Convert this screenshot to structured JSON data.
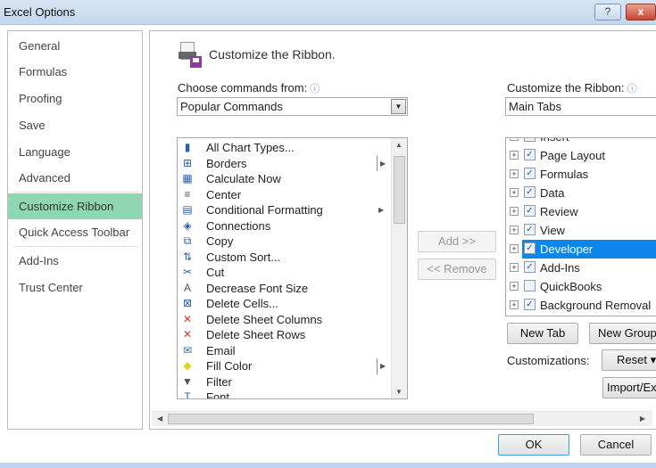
{
  "window": {
    "title": "Excel Options",
    "help": "?",
    "close": "x"
  },
  "nav": {
    "items": [
      {
        "label": "General"
      },
      {
        "label": "Formulas"
      },
      {
        "label": "Proofing"
      },
      {
        "label": "Save"
      },
      {
        "label": "Language"
      },
      {
        "label": "Advanced"
      },
      {
        "label": "Customize Ribbon",
        "selected": true
      },
      {
        "label": "Quick Access Toolbar"
      },
      {
        "label": "Add-Ins"
      },
      {
        "label": "Trust Center"
      }
    ]
  },
  "header": {
    "title": "Customize the Ribbon."
  },
  "left": {
    "label": "Choose commands from:",
    "value": "Popular Commands",
    "commands": [
      {
        "label": "All Chart Types...",
        "icon": "chart-icon"
      },
      {
        "label": "Borders",
        "icon": "borders-icon",
        "submenu": "split"
      },
      {
        "label": "Calculate Now",
        "icon": "calculator-icon"
      },
      {
        "label": "Center",
        "icon": "align-center-icon"
      },
      {
        "label": "Conditional Formatting",
        "icon": "conditional-formatting-icon",
        "submenu": "arrow"
      },
      {
        "label": "Connections",
        "icon": "connections-icon"
      },
      {
        "label": "Copy",
        "icon": "copy-icon"
      },
      {
        "label": "Custom Sort...",
        "icon": "sort-icon"
      },
      {
        "label": "Cut",
        "icon": "scissors-icon"
      },
      {
        "label": "Decrease Font Size",
        "icon": "decrease-font-icon"
      },
      {
        "label": "Delete Cells...",
        "icon": "delete-cells-icon"
      },
      {
        "label": "Delete Sheet Columns",
        "icon": "delete-columns-icon"
      },
      {
        "label": "Delete Sheet Rows",
        "icon": "delete-rows-icon"
      },
      {
        "label": "Email",
        "icon": "email-icon"
      },
      {
        "label": "Fill Color",
        "icon": "fill-color-icon",
        "submenu": "split"
      },
      {
        "label": "Filter",
        "icon": "filter-icon"
      },
      {
        "label": "Font",
        "icon": "font-icon"
      }
    ]
  },
  "middle": {
    "add": "Add >>",
    "remove": "<< Remove"
  },
  "right": {
    "label": "Customize the Ribbon:",
    "value": "Main Tabs",
    "tabs": [
      {
        "label": "Insert",
        "checked": true
      },
      {
        "label": "Page Layout",
        "checked": true
      },
      {
        "label": "Formulas",
        "checked": true
      },
      {
        "label": "Data",
        "checked": true
      },
      {
        "label": "Review",
        "checked": true
      },
      {
        "label": "View",
        "checked": true
      },
      {
        "label": "Developer",
        "checked": true,
        "selected": true
      },
      {
        "label": "Add-Ins",
        "checked": true
      },
      {
        "label": "QuickBooks",
        "checked": false
      },
      {
        "label": "Background Removal",
        "checked": true
      }
    ],
    "new_tab": "New Tab",
    "new_group": "New Group",
    "customizations": "Customizations:",
    "reset": "Reset ▾",
    "import_export": "Import/Export"
  },
  "footer": {
    "ok": "OK",
    "cancel": "Cancel"
  },
  "colors": {
    "nav_selected": "#8fd6b2",
    "tree_selected": "#0c86ea",
    "title_bar": "#c9dcef"
  }
}
